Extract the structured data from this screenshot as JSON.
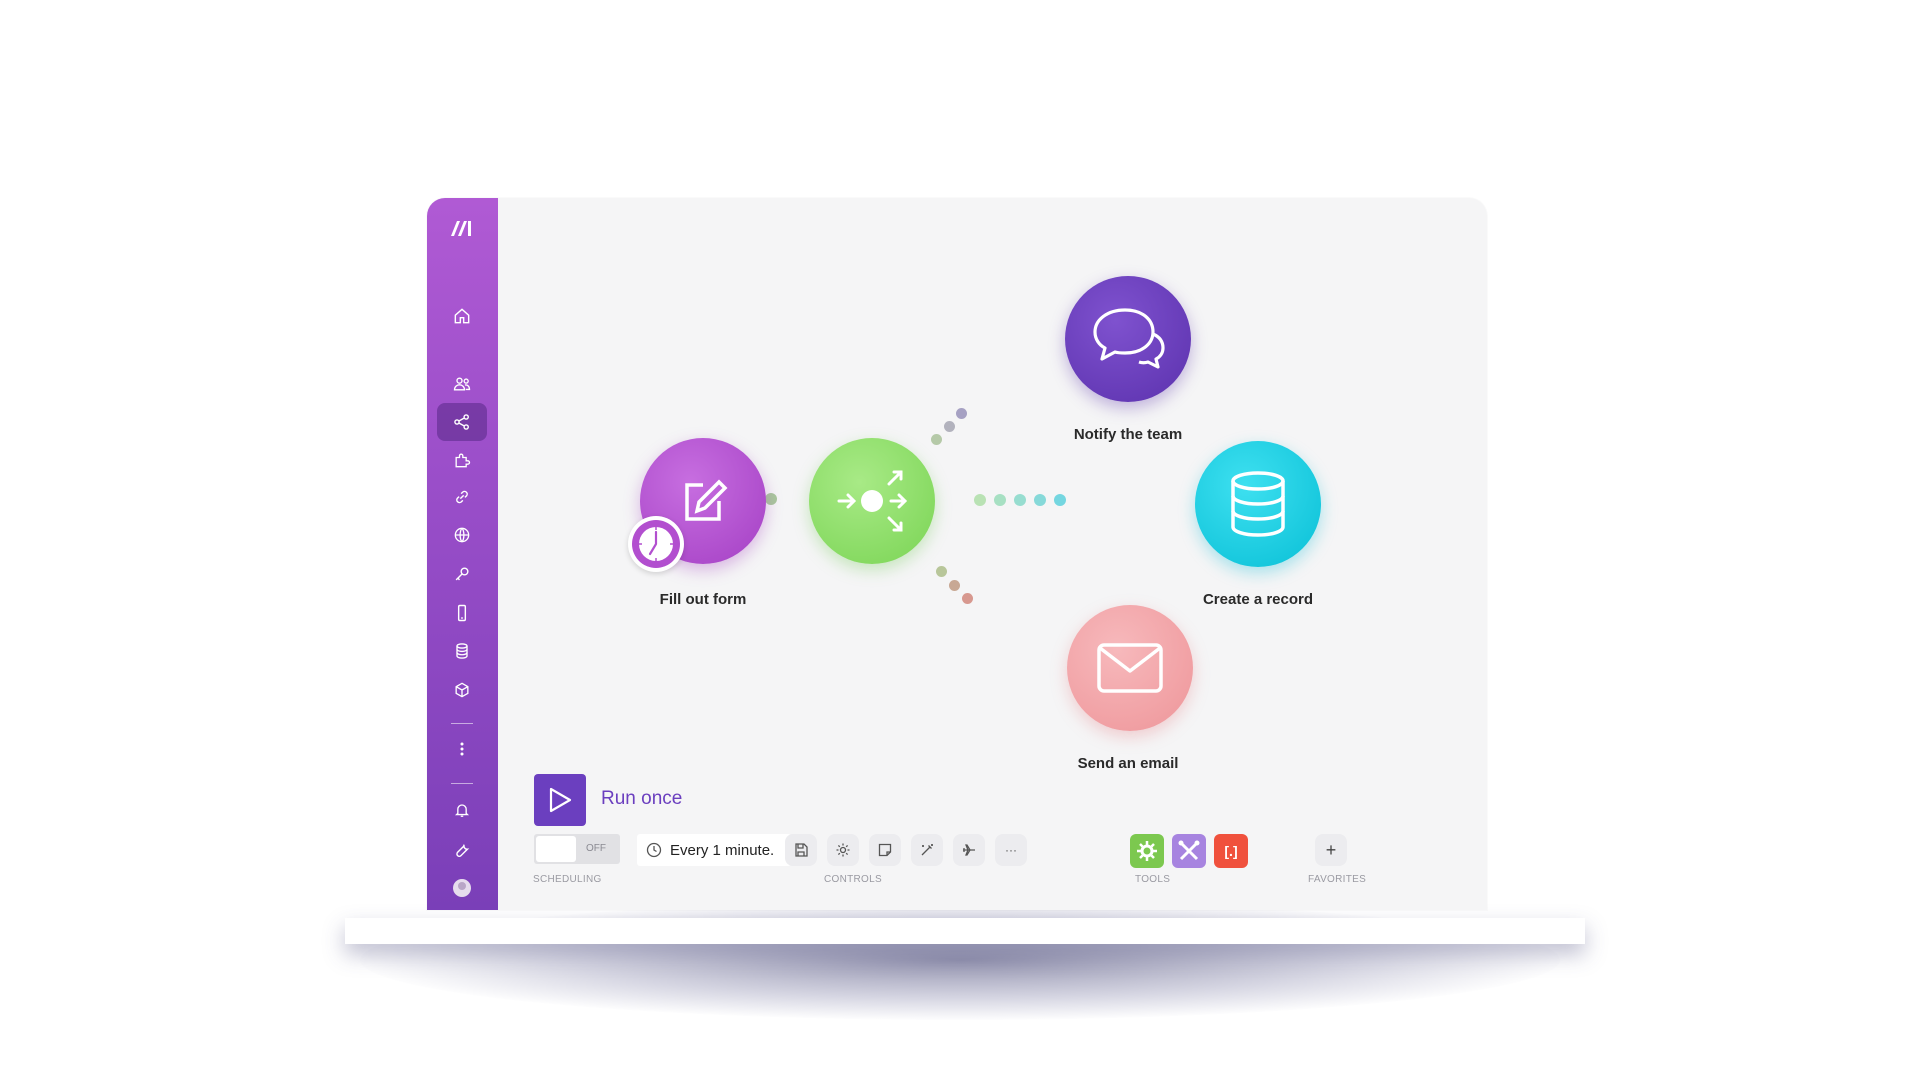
{
  "nodes": {
    "form": {
      "label": "Fill out form",
      "color": "#b44fcf"
    },
    "router": {
      "color": "#8ee06a"
    },
    "notify": {
      "label": "Notify the team",
      "color": "#6b3fbf"
    },
    "record": {
      "label": "Create a record",
      "color": "#16cfe3"
    },
    "email": {
      "label": "Send an email",
      "color": "#f3a3a7"
    }
  },
  "run": {
    "label": "Run once"
  },
  "scheduling": {
    "toggle_state": "OFF",
    "interval": "Every 1 minute.",
    "section_label": "SCHEDULING"
  },
  "controls": {
    "section_label": "CONTROLS",
    "items": [
      "save-icon",
      "gear-icon",
      "note-icon",
      "magic-wand-icon",
      "airplane-icon",
      "more-icon"
    ],
    "more_label": "···"
  },
  "tools": {
    "section_label": "TOOLS",
    "items": [
      {
        "name": "flow-control-icon",
        "color": "#7cc84f"
      },
      {
        "name": "tools-icon",
        "color": "#a784e0"
      },
      {
        "name": "text-parser-icon",
        "color": "#f0513d",
        "glyph": "[.]"
      }
    ]
  },
  "favorites": {
    "section_label": "FAVORITES",
    "add_label": "+"
  },
  "sidebar": {
    "items": [
      "home-icon",
      "team-icon",
      "scenarios-icon",
      "templates-icon",
      "connections-icon",
      "webhooks-icon",
      "keys-icon",
      "devices-icon",
      "data-stores-icon",
      "data-structures-icon",
      "more-icon",
      "notifications-icon",
      "resource-hub-icon",
      "avatar"
    ],
    "active": "scenarios-icon"
  }
}
